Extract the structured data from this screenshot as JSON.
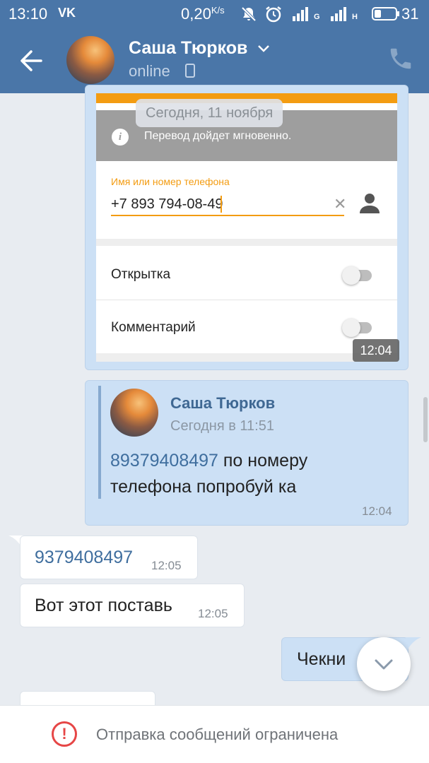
{
  "status_bar": {
    "time": "13:10",
    "app_icon": "VK",
    "speed": "0,20",
    "speed_unit": "K/s",
    "icons": [
      "bell-off-icon",
      "alarm-icon",
      "signal-icon",
      "signal-icon"
    ],
    "network_1": "G",
    "network_2": "H",
    "battery_percent": "31",
    "battery_level": 0.31
  },
  "header": {
    "contact_name": "Саша Тюрков",
    "status": "online",
    "colors": {
      "bar": "#4a76a8"
    }
  },
  "shared_screenshot": {
    "date_chip": "Сегодня, 11 ноября",
    "info_text": "Перевод дойдет мгновенно.",
    "phone_label": "Имя или номер телефона",
    "phone_value": "+7 893 794-08-49",
    "option_1": "Открытка",
    "option_2": "Комментарий",
    "time": "12:04",
    "accent_color": "#f39c12"
  },
  "forwarded_message": {
    "author": "Саша Тюрков",
    "date": "Сегодня в 11:51",
    "text_link": "89379408497",
    "text_rest": " по номеру телефона попробуй ка",
    "time": "12:04"
  },
  "messages": [
    {
      "text": "9379408497",
      "time": "12:05",
      "is_link": true
    },
    {
      "text": "Вот этот поставь",
      "time": "12:05"
    },
    {
      "text": "Чекни",
      "outgoing": true
    }
  ],
  "bottom_bar": {
    "warning_text": "Отправка сообщений ограничена",
    "warning_color": "#e64646"
  }
}
